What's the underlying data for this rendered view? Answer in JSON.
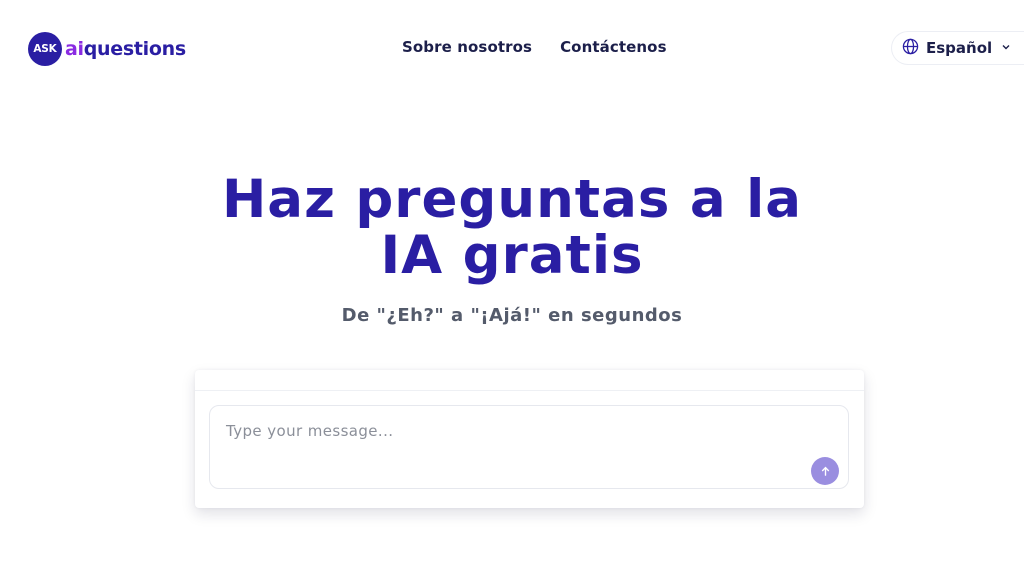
{
  "header": {
    "logo_badge": "ASK",
    "logo_prefix": "ai",
    "logo_suffix": "questions",
    "nav": [
      {
        "label": "Sobre nosotros"
      },
      {
        "label": "Contáctenos"
      }
    ],
    "language": "Español"
  },
  "hero": {
    "title_line1": "Haz preguntas a la",
    "title_line2": "IA gratis",
    "subtitle": "De \"¿Eh?\" a \"¡Ajá!\" en segundos"
  },
  "chat": {
    "placeholder": "Type your message..."
  },
  "colors": {
    "brand": "#2a1ea3",
    "accent": "#8a2be2",
    "send_button": "#9a8ee0"
  },
  "icons": {
    "language": "globe-icon",
    "dropdown": "chevron-down-icon",
    "send": "arrow-up-icon"
  }
}
